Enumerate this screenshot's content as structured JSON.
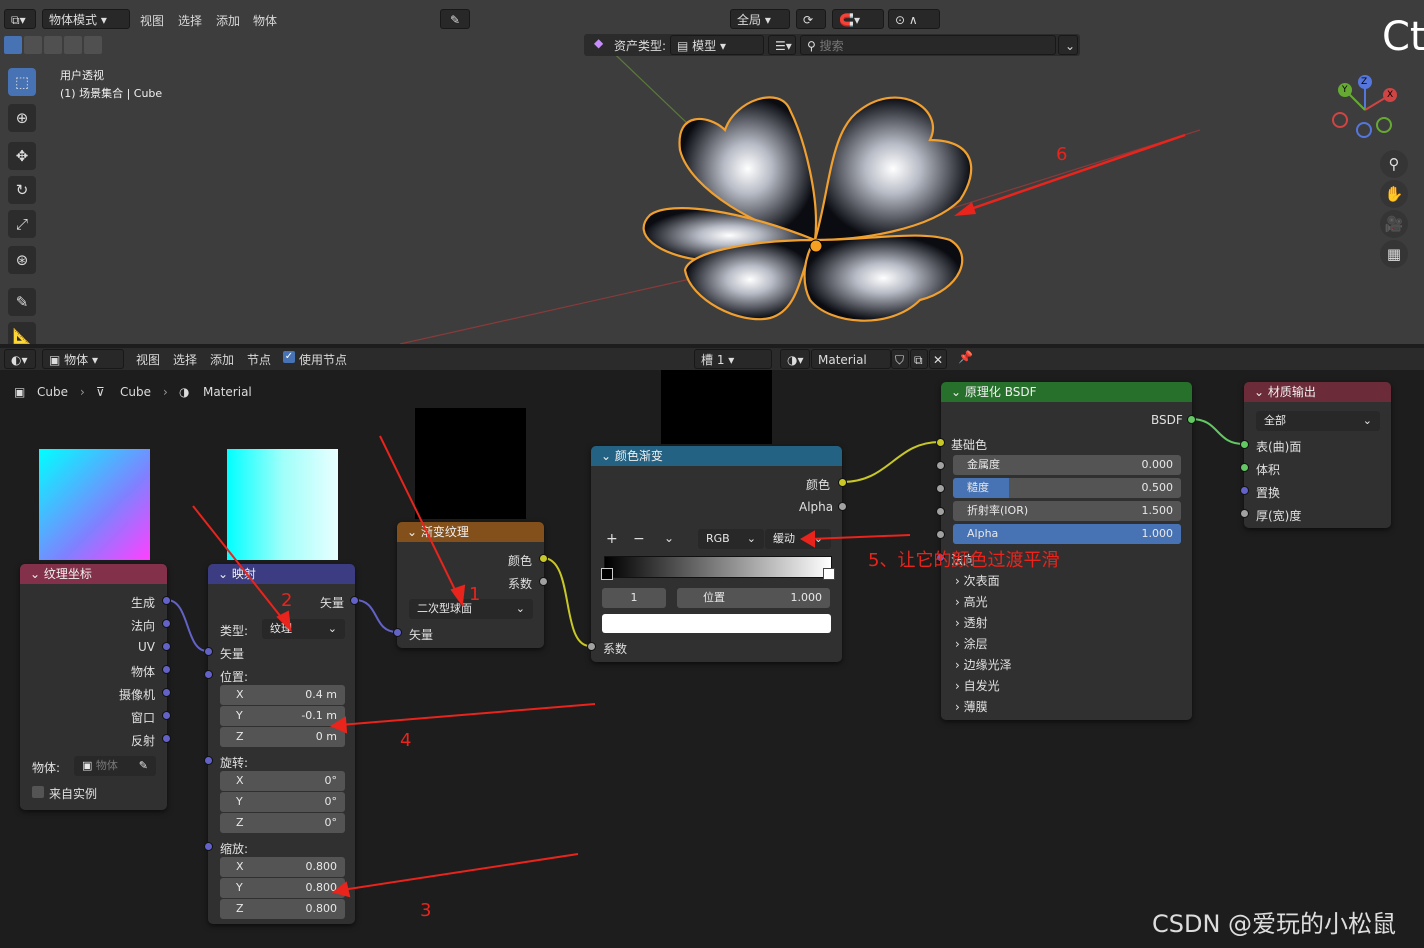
{
  "viewport": {
    "header": {
      "mode": "物体模式",
      "menus": [
        "视图",
        "选择",
        "添加",
        "物体"
      ],
      "transform_orientation": "全局",
      "ct_text": "Ct"
    },
    "asset_bar": {
      "label": "资产类型:",
      "value": "模型",
      "search_placeholder": "搜索"
    },
    "view_name": "用户透视",
    "collection": "(1) 场景集合 | Cube",
    "gizmo": {
      "x": "X",
      "y": "Y",
      "z": "Z"
    },
    "annotation_6": "6"
  },
  "node_editor": {
    "header": {
      "type": "物体",
      "menus": [
        "视图",
        "选择",
        "添加",
        "节点"
      ],
      "use_nodes": "使用节点",
      "slot": "槽 1",
      "material": "Material"
    },
    "breadcrumb": [
      "Cube",
      "Cube",
      "Material"
    ],
    "nodes": {
      "texcoord": {
        "title": "纹理坐标",
        "outputs": [
          "生成",
          "法向",
          "UV",
          "物体",
          "摄像机",
          "窗口",
          "反射"
        ],
        "object_label": "物体:",
        "object_placeholder": "物体",
        "from_instancer": "来自实例"
      },
      "mapping": {
        "title": "映射",
        "output": "矢量",
        "type_label": "类型:",
        "type_value": "纹理",
        "input_vector": "矢量",
        "location": {
          "label": "位置:",
          "x": "0.4 m",
          "y": "-0.1 m",
          "z": "0 m"
        },
        "rotation": {
          "label": "旋转:",
          "x": "0°",
          "y": "0°",
          "z": "0°"
        },
        "scale": {
          "label": "缩放:",
          "x": "0.800",
          "y": "0.800",
          "z": "0.800"
        },
        "axis": [
          "X",
          "Y",
          "Z"
        ]
      },
      "gradient": {
        "title": "渐变纹理",
        "out_color": "颜色",
        "out_fac": "系数",
        "type_value": "二次型球面",
        "input_vector": "矢量"
      },
      "ramp": {
        "title": "颜色渐变",
        "out_color": "颜色",
        "out_alpha": "Alpha",
        "color_mode": "RGB",
        "interp": "缓动",
        "index": "1",
        "pos_label": "位置",
        "pos_value": "1.000",
        "input_fac": "系数"
      },
      "bsdf": {
        "title": "原理化 BSDF",
        "out": "BSDF",
        "base_color": "基础色",
        "metallic": {
          "label": "金属度",
          "value": "0.000"
        },
        "roughness": {
          "label": "糙度",
          "value": "0.500",
          "fill": 0.5
        },
        "ior": {
          "label": "折射率(IOR)",
          "value": "1.500"
        },
        "alpha": {
          "label": "Alpha",
          "value": "1.000",
          "fill": 1.0
        },
        "normal": "法向",
        "panels": [
          "次表面",
          "高光",
          "透射",
          "涂层",
          "边缘光泽",
          "自发光",
          "薄膜"
        ]
      },
      "output": {
        "title": "材质输出",
        "target": "全部",
        "inputs": [
          "表(曲)面",
          "体积",
          "置换",
          "厚(宽)度"
        ]
      }
    },
    "annotations": {
      "a1": "1",
      "a2": "2",
      "a3": "3",
      "a4": "4",
      "a5": "5、让它的颜色过渡平滑"
    },
    "colors": {
      "texcoord": "#83314a",
      "mapping": "#3c3c83",
      "gradient": "#83501c",
      "ramp": "#246283",
      "bsdf": "#27702c",
      "output": "#6b2b38",
      "annotation": "#e8241c"
    }
  },
  "watermark": "CSDN @爱玩的小松鼠"
}
